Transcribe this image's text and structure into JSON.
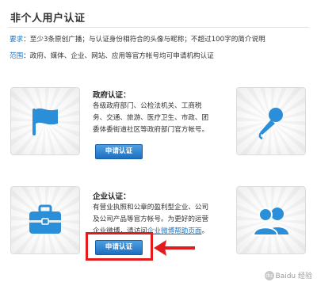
{
  "page": {
    "title": "非个人用户认证"
  },
  "requirements": {
    "label": "要求",
    "text": "：至少3条原创广播；与认证身份相符合的头像与昵称；不超过100字的简介说明"
  },
  "scope": {
    "label": "范围",
    "text": "：政府、媒体、企业、网站、应用等官方帐号均可申请机构认证"
  },
  "sections": [
    {
      "title": "政府认证：",
      "desc_lines": [
        "各级政府部门、公检法机关、工商税",
        "务、交通、旅游、医疗卫生、市政、团",
        "委体委街道社区等政府部门官方帐号。"
      ],
      "button_label": "申请认证",
      "left_icon": "flag-icon",
      "right_icon": "microphone-icon"
    },
    {
      "title": "企业认证：",
      "desc_lines": [
        "有营业执照和公章的盈利型企业、公司",
        "及公司产品等官方帐号。为更好的运营",
        "企业微博，请访问"
      ],
      "desc_link": "企业微博帮助页面",
      "desc_end": "。",
      "button_label": "申请认证",
      "left_icon": "briefcase-icon",
      "right_icon": "users-icon"
    }
  ],
  "watermark": {
    "paw": "du",
    "text": "Baidu 经验"
  },
  "colors": {
    "accent_blue": "#1a76c4",
    "icon_blue": "#2a8fd8",
    "highlight_red": "#e21c1c"
  }
}
